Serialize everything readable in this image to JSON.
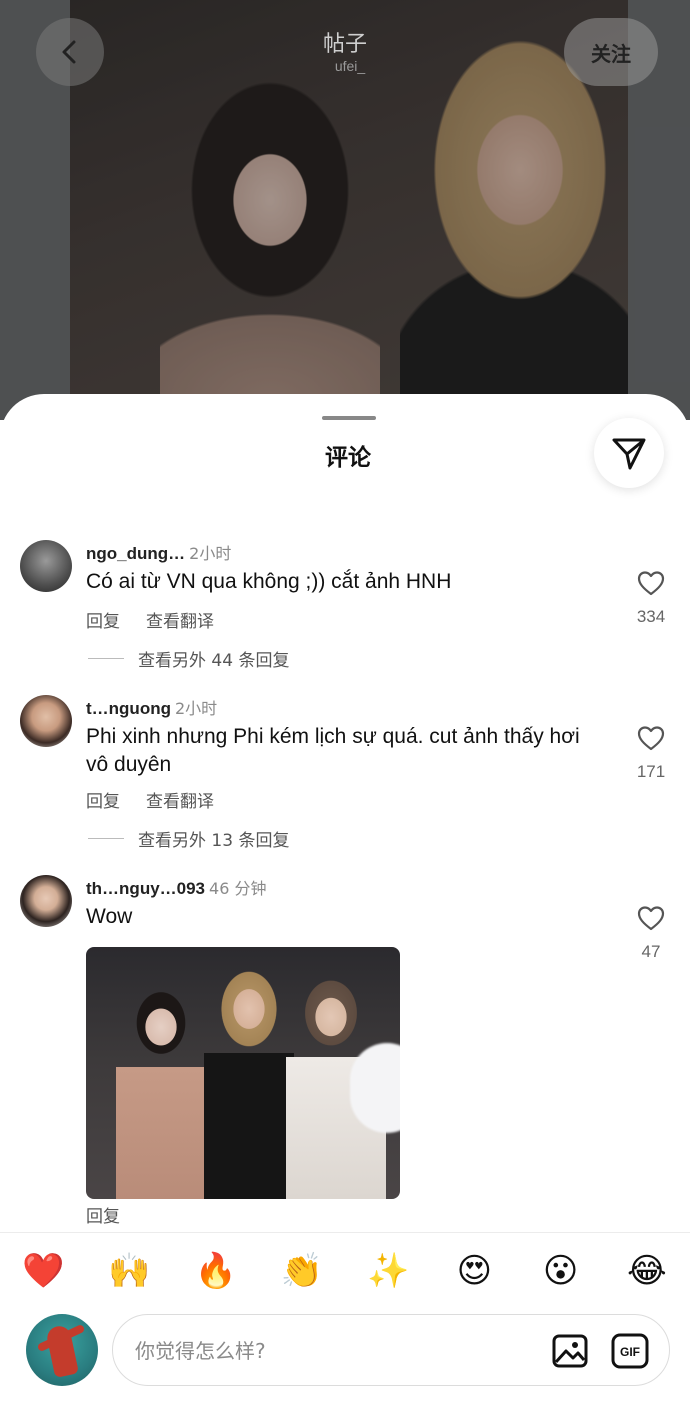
{
  "header": {
    "title": "帖子",
    "subtitle": "ufei_",
    "follow_label": "关注",
    "back_icon": "back-chevron-icon"
  },
  "sheet": {
    "title": "评论",
    "share_icon": "send-icon"
  },
  "comments": [
    {
      "user": "ngo_dung…",
      "time": "2小时",
      "text": "Có ai từ VN qua không ;)) cắt ảnh HNH",
      "reply_label": "回复",
      "translate_label": "查看翻译",
      "more_replies": "查看另外 44 条回复",
      "likes": "334"
    },
    {
      "user": "t…nguong",
      "time": "2小时",
      "text": "Phi xinh nhưng Phi kém lịch sự quá. cut ảnh thấy hơi vô duyên",
      "reply_label": "回复",
      "translate_label": "查看翻译",
      "more_replies": "查看另外 13 条回复",
      "likes": "171"
    },
    {
      "user": "th…nguy…093",
      "time": "46 分钟",
      "text": "Wow",
      "reply_label": "回复",
      "likes": "47"
    }
  ],
  "emojis": [
    "❤️",
    "🙌",
    "🔥",
    "👏",
    "✨",
    "😍",
    "😮",
    "😂"
  ],
  "composer": {
    "placeholder": "你觉得怎么样?",
    "image_icon": "image-icon",
    "gif_icon": "gif-icon",
    "gif_label": "GIF"
  }
}
